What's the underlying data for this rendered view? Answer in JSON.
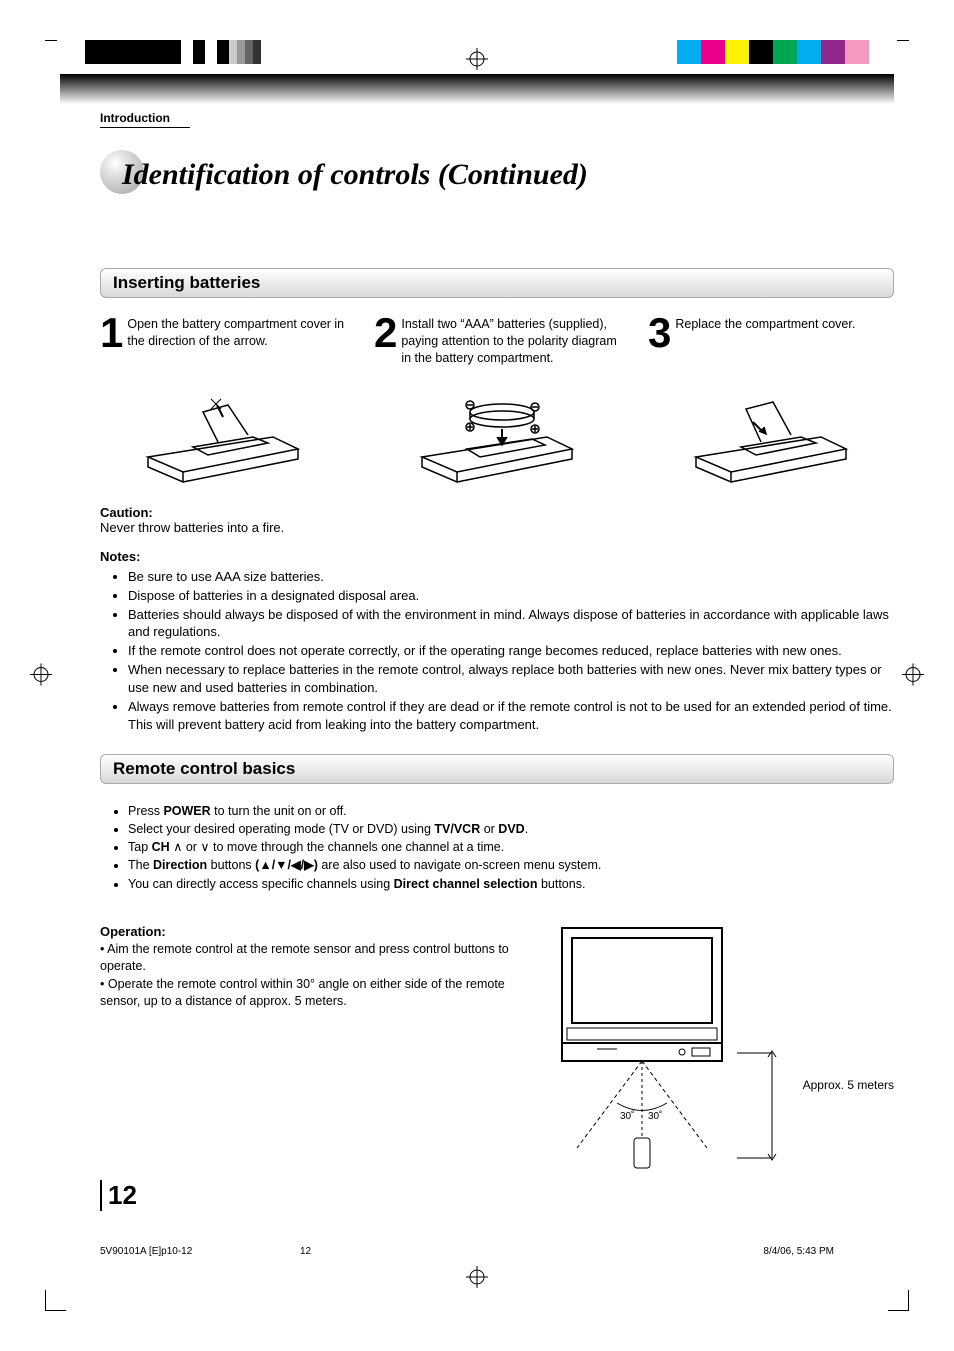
{
  "chapter": "Introduction",
  "title": "Identification of controls (Continued)",
  "section1": {
    "heading": "Inserting batteries",
    "step1_num": "1",
    "step1_text": "Open the battery compartment cover in the direction of the arrow.",
    "step2_num": "2",
    "step2_text": "Install two “AAA” batteries (supplied), paying attention to the polarity diagram in the battery compartment.",
    "step3_num": "3",
    "step3_text": "Replace the compartment cover.",
    "caution_label": "Caution:",
    "caution_text": "Never throw batteries into a fire.",
    "notes_label": "Notes:",
    "notes": [
      "Be sure to use AAA size batteries.",
      "Dispose of batteries in a designated disposal area.",
      "Batteries should always be disposed of with the environment in mind. Always dispose of batteries in accordance with applicable laws and regulations.",
      "If the remote control does not operate correctly, or if the operating range becomes reduced, replace batteries with new ones.",
      "When necessary to replace batteries in the remote control, always replace both batteries with new ones. Never mix battery types or use new and used batteries in combination.",
      "Always remove batteries from remote control if they are dead or if the remote control is not to be used for an extended period of time. This will prevent battery acid from leaking into the battery compartment."
    ]
  },
  "section2": {
    "heading": "Remote control basics",
    "items": {
      "press": "Press ",
      "power": "POWER",
      "power_tail": " to turn the unit on or off.",
      "select_head": "Select your desired operating mode (TV or DVD) using ",
      "tv_vcr": "TV/VCR",
      "or": " or ",
      "dvd": "DVD",
      "period": ".",
      "tap_head": "Tap ",
      "ch": "CH",
      "tap_tail": " to move through the channels one channel at a time.",
      "dir_head": "The ",
      "direction": "Direction",
      "dir_mid": " buttons ",
      "arrows": "(▲/▼/◀/▶)",
      "dir_tail": " are also used to navigate on-screen menu system.",
      "direct_head": "You can directly access specific channels using ",
      "direct_sel": "Direct channel selection",
      "direct_tail": " buttons."
    },
    "operation_label": "Operation:",
    "op1": "• Aim the remote control at the remote sensor and press control buttons to operate.",
    "op2": "• Operate the remote control within 30° angle on either side of the remote sensor, up to a distance of approx. 5 meters.",
    "range_label": "Approx. 5 meters",
    "angle_left": "30˚",
    "angle_right": "30˚"
  },
  "colors_left": [
    "#000",
    "#000",
    "#000",
    "#000",
    "#fff",
    "#fff",
    "#000",
    "#fff",
    "#fff"
  ],
  "colors_right": [
    "#00aeef",
    "#ec008c",
    "#fff200",
    "#000",
    "#00a651",
    "#00adee",
    "#92278f",
    "#f49ac1",
    "#fff"
  ],
  "footer": {
    "file": "5V90101A [E]p10-12",
    "page_sub": "12",
    "datetime": "8/4/06, 5:43 PM"
  },
  "page_number": "12"
}
